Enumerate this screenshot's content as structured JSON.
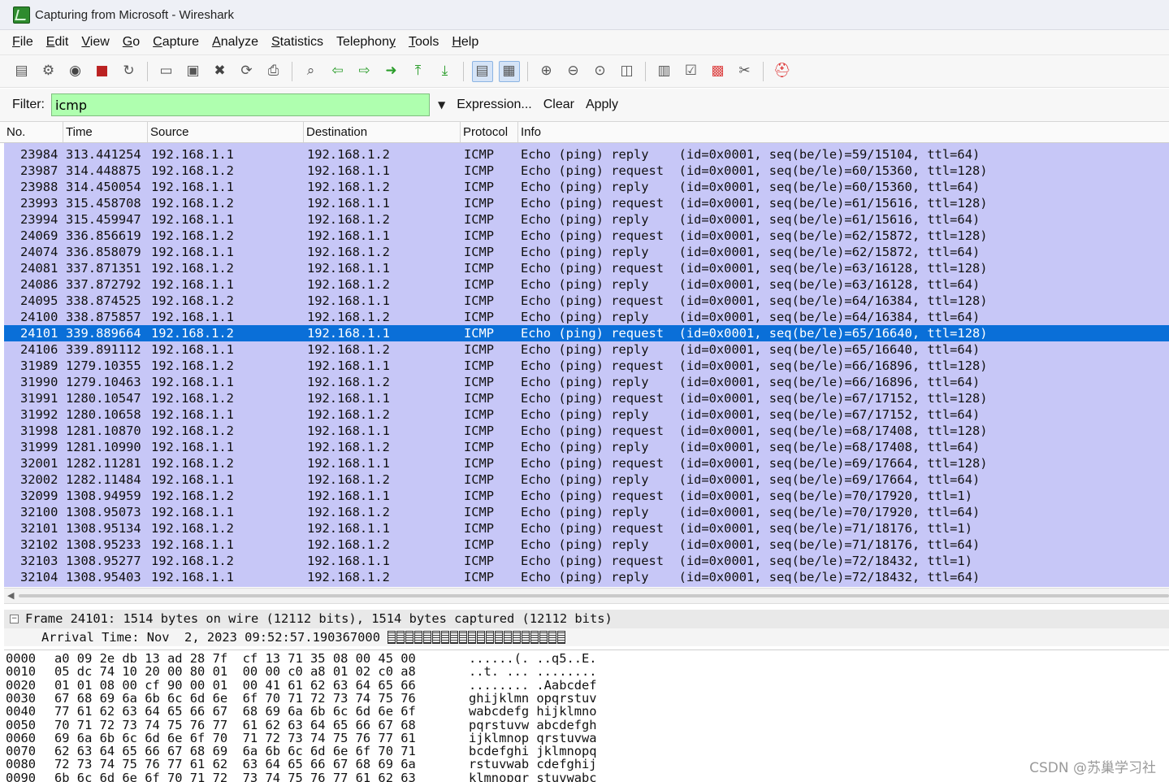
{
  "window": {
    "title": "Capturing from Microsoft - Wireshark"
  },
  "menu": [
    {
      "label": "File",
      "u": "F",
      "rest": "ile"
    },
    {
      "label": "Edit",
      "u": "E",
      "rest": "dit"
    },
    {
      "label": "View",
      "u": "V",
      "rest": "iew"
    },
    {
      "label": "Go",
      "u": "G",
      "rest": "o"
    },
    {
      "label": "Capture",
      "u": "C",
      "rest": "apture"
    },
    {
      "label": "Analyze",
      "u": "A",
      "rest": "nalyze"
    },
    {
      "label": "Statistics",
      "u": "S",
      "rest": "tatistics"
    },
    {
      "label": "Telephony",
      "pre": "Telephon",
      "u": "y",
      "rest": ""
    },
    {
      "label": "Tools",
      "u": "T",
      "rest": "ools"
    },
    {
      "label": "Help",
      "u": "H",
      "rest": "elp"
    }
  ],
  "toolbar_icons": [
    "interface-list-icon",
    "capture-options-icon",
    "start-capture-icon",
    "stop-capture-icon",
    "restart-capture-icon",
    "|",
    "open-file-icon",
    "save-file-icon",
    "close-file-icon",
    "reload-icon",
    "print-icon",
    "|",
    "find-packet-icon",
    "go-back-icon",
    "go-forward-icon",
    "go-to-packet-icon",
    "go-first-icon",
    "go-last-icon",
    "|",
    "colorize-icon",
    "auto-scroll-icon",
    "|",
    "zoom-in-icon",
    "zoom-out-icon",
    "normal-size-icon",
    "resize-columns-icon",
    "|",
    "capture-filters-icon",
    "display-filters-icon",
    "coloring-rules-icon",
    "preferences-icon",
    "|",
    "help-icon"
  ],
  "filter": {
    "label": "Filter:",
    "value": "icmp",
    "expression": "Expression...",
    "clear": "Clear",
    "apply": "Apply"
  },
  "columns": [
    "No.",
    "Time",
    "Source",
    "Destination",
    "Protocol",
    "Info"
  ],
  "packets": [
    [
      "23984",
      "313.441254",
      "192.168.1.1",
      "192.168.1.2",
      "ICMP",
      "Echo (ping) reply    (id=0x0001, seq(be/le)=59/15104, ttl=64)"
    ],
    [
      "23987",
      "314.448875",
      "192.168.1.2",
      "192.168.1.1",
      "ICMP",
      "Echo (ping) request  (id=0x0001, seq(be/le)=60/15360, ttl=128)"
    ],
    [
      "23988",
      "314.450054",
      "192.168.1.1",
      "192.168.1.2",
      "ICMP",
      "Echo (ping) reply    (id=0x0001, seq(be/le)=60/15360, ttl=64)"
    ],
    [
      "23993",
      "315.458708",
      "192.168.1.2",
      "192.168.1.1",
      "ICMP",
      "Echo (ping) request  (id=0x0001, seq(be/le)=61/15616, ttl=128)"
    ],
    [
      "23994",
      "315.459947",
      "192.168.1.1",
      "192.168.1.2",
      "ICMP",
      "Echo (ping) reply    (id=0x0001, seq(be/le)=61/15616, ttl=64)"
    ],
    [
      "24069",
      "336.856619",
      "192.168.1.2",
      "192.168.1.1",
      "ICMP",
      "Echo (ping) request  (id=0x0001, seq(be/le)=62/15872, ttl=128)"
    ],
    [
      "24074",
      "336.858079",
      "192.168.1.1",
      "192.168.1.2",
      "ICMP",
      "Echo (ping) reply    (id=0x0001, seq(be/le)=62/15872, ttl=64)"
    ],
    [
      "24081",
      "337.871351",
      "192.168.1.2",
      "192.168.1.1",
      "ICMP",
      "Echo (ping) request  (id=0x0001, seq(be/le)=63/16128, ttl=128)"
    ],
    [
      "24086",
      "337.872792",
      "192.168.1.1",
      "192.168.1.2",
      "ICMP",
      "Echo (ping) reply    (id=0x0001, seq(be/le)=63/16128, ttl=64)"
    ],
    [
      "24095",
      "338.874525",
      "192.168.1.2",
      "192.168.1.1",
      "ICMP",
      "Echo (ping) request  (id=0x0001, seq(be/le)=64/16384, ttl=128)"
    ],
    [
      "24100",
      "338.875857",
      "192.168.1.1",
      "192.168.1.2",
      "ICMP",
      "Echo (ping) reply    (id=0x0001, seq(be/le)=64/16384, ttl=64)"
    ],
    [
      "24101",
      "339.889664",
      "192.168.1.2",
      "192.168.1.1",
      "ICMP",
      "Echo (ping) request  (id=0x0001, seq(be/le)=65/16640, ttl=128)"
    ],
    [
      "24106",
      "339.891112",
      "192.168.1.1",
      "192.168.1.2",
      "ICMP",
      "Echo (ping) reply    (id=0x0001, seq(be/le)=65/16640, ttl=64)"
    ],
    [
      "31989",
      "1279.10355",
      "192.168.1.2",
      "192.168.1.1",
      "ICMP",
      "Echo (ping) request  (id=0x0001, seq(be/le)=66/16896, ttl=128)"
    ],
    [
      "31990",
      "1279.10463",
      "192.168.1.1",
      "192.168.1.2",
      "ICMP",
      "Echo (ping) reply    (id=0x0001, seq(be/le)=66/16896, ttl=64)"
    ],
    [
      "31991",
      "1280.10547",
      "192.168.1.2",
      "192.168.1.1",
      "ICMP",
      "Echo (ping) request  (id=0x0001, seq(be/le)=67/17152, ttl=128)"
    ],
    [
      "31992",
      "1280.10658",
      "192.168.1.1",
      "192.168.1.2",
      "ICMP",
      "Echo (ping) reply    (id=0x0001, seq(be/le)=67/17152, ttl=64)"
    ],
    [
      "31998",
      "1281.10870",
      "192.168.1.2",
      "192.168.1.1",
      "ICMP",
      "Echo (ping) request  (id=0x0001, seq(be/le)=68/17408, ttl=128)"
    ],
    [
      "31999",
      "1281.10990",
      "192.168.1.1",
      "192.168.1.2",
      "ICMP",
      "Echo (ping) reply    (id=0x0001, seq(be/le)=68/17408, ttl=64)"
    ],
    [
      "32001",
      "1282.11281",
      "192.168.1.2",
      "192.168.1.1",
      "ICMP",
      "Echo (ping) request  (id=0x0001, seq(be/le)=69/17664, ttl=128)"
    ],
    [
      "32002",
      "1282.11484",
      "192.168.1.1",
      "192.168.1.2",
      "ICMP",
      "Echo (ping) reply    (id=0x0001, seq(be/le)=69/17664, ttl=64)"
    ],
    [
      "32099",
      "1308.94959",
      "192.168.1.2",
      "192.168.1.1",
      "ICMP",
      "Echo (ping) request  (id=0x0001, seq(be/le)=70/17920, ttl=1)"
    ],
    [
      "32100",
      "1308.95073",
      "192.168.1.1",
      "192.168.1.2",
      "ICMP",
      "Echo (ping) reply    (id=0x0001, seq(be/le)=70/17920, ttl=64)"
    ],
    [
      "32101",
      "1308.95134",
      "192.168.1.2",
      "192.168.1.1",
      "ICMP",
      "Echo (ping) request  (id=0x0001, seq(be/le)=71/18176, ttl=1)"
    ],
    [
      "32102",
      "1308.95233",
      "192.168.1.1",
      "192.168.1.2",
      "ICMP",
      "Echo (ping) reply    (id=0x0001, seq(be/le)=71/18176, ttl=64)"
    ],
    [
      "32103",
      "1308.95277",
      "192.168.1.2",
      "192.168.1.1",
      "ICMP",
      "Echo (ping) request  (id=0x0001, seq(be/le)=72/18432, ttl=1)"
    ],
    [
      "32104",
      "1308.95403",
      "192.168.1.1",
      "192.168.1.2",
      "ICMP",
      "Echo (ping) reply    (id=0x0001, seq(be/le)=72/18432, ttl=64)"
    ]
  ],
  "selected_packet": "24101",
  "details": {
    "frame": "Frame 24101: 1514 bytes on wire (12112 bits), 1514 bytes captured (12112 bits)",
    "arrival": "Arrival Time: Nov  2, 2023 09:52:57.190367000"
  },
  "hex_rows": [
    {
      "offset": "0000",
      "bytes": "a0 09 2e db 13 ad 28 7f  cf 13 71 35 08 00 45 00",
      "ascii": "......(. ..q5..E."
    },
    {
      "offset": "0010",
      "bytes": "05 dc 74 10 20 00 80 01  00 00 c0 a8 01 02 c0 a8",
      "ascii": "..t. ... ........"
    },
    {
      "offset": "0020",
      "bytes": "01 01 08 00 cf 90 00 01  00 41 61 62 63 64 65 66",
      "ascii": "........ .Aabcdef"
    },
    {
      "offset": "0030",
      "bytes": "67 68 69 6a 6b 6c 6d 6e  6f 70 71 72 73 74 75 76",
      "ascii": "ghijklmn opqrstuv"
    },
    {
      "offset": "0040",
      "bytes": "77 61 62 63 64 65 66 67  68 69 6a 6b 6c 6d 6e 6f",
      "ascii": "wabcdefg hijklmno"
    },
    {
      "offset": "0050",
      "bytes": "70 71 72 73 74 75 76 77  61 62 63 64 65 66 67 68",
      "ascii": "pqrstuvw abcdefgh"
    },
    {
      "offset": "0060",
      "bytes": "69 6a 6b 6c 6d 6e 6f 70  71 72 73 74 75 76 77 61",
      "ascii": "ijklmnop qrstuvwa"
    },
    {
      "offset": "0070",
      "bytes": "62 63 64 65 66 67 68 69  6a 6b 6c 6d 6e 6f 70 71",
      "ascii": "bcdefghi jklmnopq"
    },
    {
      "offset": "0080",
      "bytes": "72 73 74 75 76 77 61 62  63 64 65 66 67 68 69 6a",
      "ascii": "rstuvwab cdefghij"
    },
    {
      "offset": "0090",
      "bytes": "6b 6c 6d 6e 6f 70 71 72  73 74 75 76 77 61 62 63",
      "ascii": "klmnopqr stuvwabc"
    }
  ],
  "watermark": "CSDN @苏巢学习社",
  "colors": {
    "row_bg": "#c7c7f7",
    "selected_bg": "#0a6fd8",
    "filter_valid_bg": "#afffaf"
  }
}
